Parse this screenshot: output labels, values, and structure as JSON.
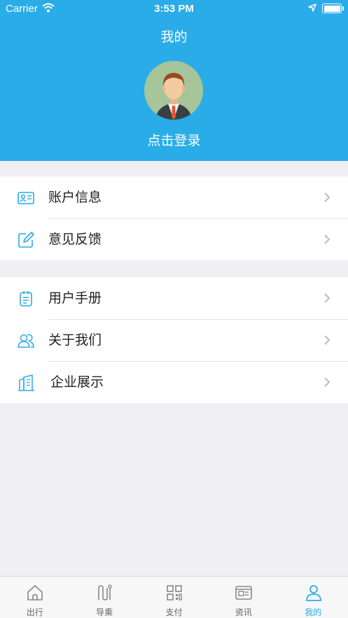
{
  "status_bar": {
    "carrier": "Carrier",
    "time": "3:53 PM"
  },
  "header": {
    "title": "我的",
    "login_text": "点击登录"
  },
  "menu_groups": [
    [
      {
        "label": "账户信息",
        "icon": "id-card-icon"
      },
      {
        "label": "意见反馈",
        "icon": "edit-icon"
      }
    ],
    [
      {
        "label": "用户手册",
        "icon": "notebook-icon"
      },
      {
        "label": "关于我们",
        "icon": "users-icon"
      },
      {
        "label": "企业展示",
        "icon": "building-icon"
      }
    ]
  ],
  "tabs": [
    {
      "label": "出行",
      "icon": "home-icon"
    },
    {
      "label": "导乘",
      "icon": "route-icon"
    },
    {
      "label": "支付",
      "icon": "qrcode-icon"
    },
    {
      "label": "资讯",
      "icon": "news-icon"
    },
    {
      "label": "我的",
      "icon": "person-icon"
    }
  ],
  "active_tab": "我的",
  "colors": {
    "accent": "#2aace8",
    "icon": "#2aace8",
    "background": "#efeff4"
  }
}
